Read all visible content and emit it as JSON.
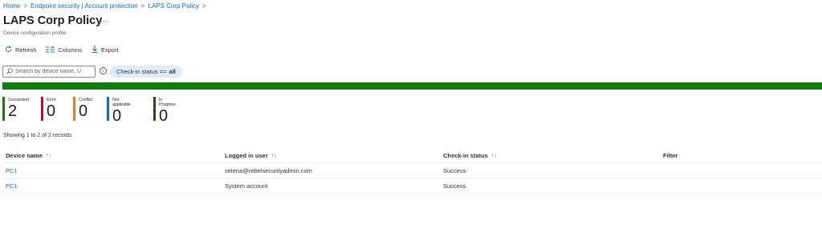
{
  "breadcrumb": [
    {
      "label": "Home"
    },
    {
      "label": "Endpoint security | Account protection"
    },
    {
      "label": "LAPS Corp Policy"
    }
  ],
  "page": {
    "title": "LAPS Corp Policy",
    "more_label": "···",
    "subtitle": "Device configuration profile"
  },
  "toolbar": {
    "refresh_label": "Refresh",
    "columns_label": "Columns",
    "export_label": "Export"
  },
  "search": {
    "placeholder": "Search by device name, U",
    "value": ""
  },
  "filter": {
    "prefix": "Check-in status ==",
    "value": "all"
  },
  "status_bar": {
    "succeeded_fraction": 1.0,
    "color": "#107c10"
  },
  "stats": [
    {
      "label": "Succeeded",
      "value": "2",
      "color": "#107c10"
    },
    {
      "label": "Error",
      "value": "0",
      "color": "#c50f1f"
    },
    {
      "label": "Conflict",
      "value": "0",
      "color": "#e3792b"
    },
    {
      "label": "Not applicable",
      "value": "0",
      "color": "#0f6cbd"
    },
    {
      "label": "In Progress",
      "value": "0",
      "color": "#4b3a17"
    }
  ],
  "records_text": "Showing 1 to 2 of 2 records",
  "table": {
    "columns": [
      "Device name",
      "Logged in user",
      "Check-in status",
      "Filter"
    ],
    "sort_icon": "↑↓",
    "rows": [
      [
        "PC1",
        "selena@rebelsecurityadmin.com",
        "Success",
        ""
      ],
      [
        "PC1",
        "System account",
        "Success",
        ""
      ]
    ]
  }
}
